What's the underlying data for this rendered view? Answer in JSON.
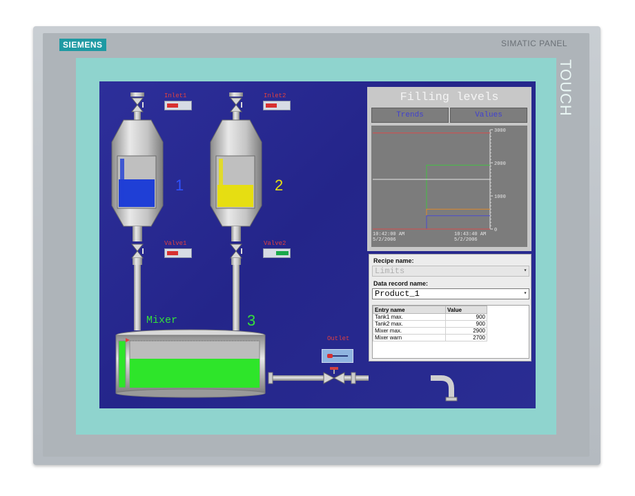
{
  "device": {
    "brand": "SIEMENS",
    "model": "SIMATIC PANEL",
    "touch": "TOUCH"
  },
  "process": {
    "inlet1_label": "Inlet1",
    "inlet2_label": "Inlet2",
    "valve1_label": "Valve1",
    "valve2_label": "Valve2",
    "outlet_label": "Outlet",
    "tank1_number": "1",
    "tank2_number": "2",
    "mixer_label": "Mixer",
    "mixer_number": "3",
    "tank1_level": 0.55,
    "tank2_level": 0.45,
    "mixer_level": 0.62,
    "colors": {
      "tank1": "#1f3fd6",
      "tank2": "#e6de12",
      "mixer": "#2ee52a",
      "gauge_red": "#d83030",
      "gauge_green": "#1aa84a"
    }
  },
  "filling": {
    "title": "Filling levels",
    "tab_trends": "Trends",
    "tab_values": "Values",
    "time_start": "10:42:00 AM",
    "date_start": "5/2/2006",
    "time_end": "10:43:40 AM",
    "date_end": "5/2/2006",
    "y_ticks": [
      "0",
      "1000",
      "2000",
      "3000"
    ]
  },
  "chart_data": {
    "type": "line",
    "title": "Filling levels",
    "xlabel": "",
    "ylabel": "",
    "ylim": [
      0,
      3000
    ],
    "x": [
      "10:42:00 AM",
      "10:43:40 AM"
    ],
    "grid": true,
    "series": [
      {
        "values": [
          2900,
          2900
        ],
        "color": "#d84a4a"
      },
      {
        "values": [
          null,
          1930
        ],
        "color": "#44c044"
      },
      {
        "values": [
          1500,
          1500
        ],
        "color": "#e8e8e8"
      },
      {
        "values": [
          null,
          600
        ],
        "color": "#e08a2a"
      },
      {
        "values": [
          null,
          400
        ],
        "color": "#4a4ad0"
      }
    ]
  },
  "recipe": {
    "recipe_name_label": "Recipe name:",
    "recipe_name_value": "Limits",
    "record_name_label": "Data record name:",
    "record_name_value": "Product_1",
    "columns": [
      "Entry name",
      "Value"
    ],
    "rows": [
      {
        "name": "Tank1 max.",
        "value": "900"
      },
      {
        "name": "Tank2 max.",
        "value": "900"
      },
      {
        "name": "Mixer max.",
        "value": "2900"
      },
      {
        "name": "Mixer warn",
        "value": "2700"
      }
    ]
  }
}
